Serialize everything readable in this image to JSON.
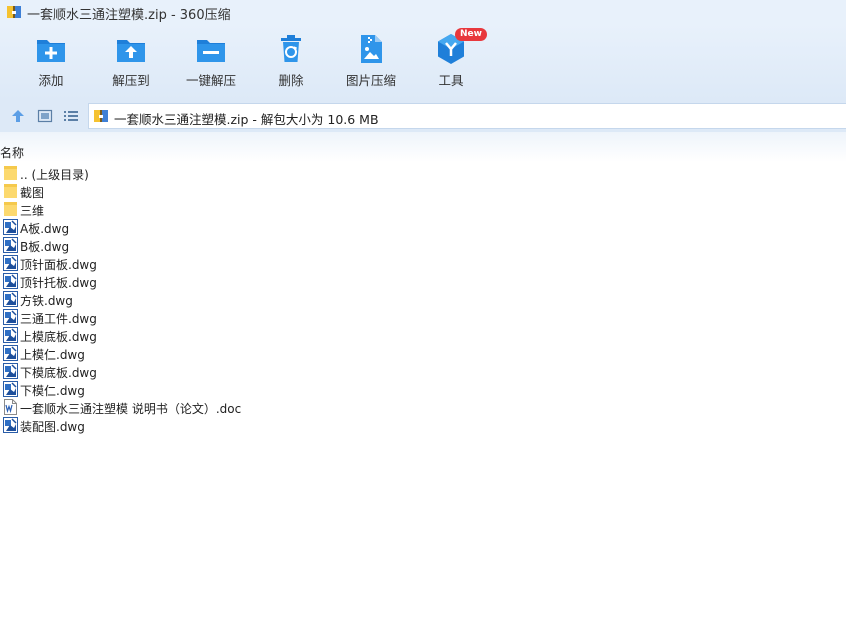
{
  "window": {
    "title": "一套顺水三通注塑模.zip - 360压缩"
  },
  "toolbar": {
    "items": [
      {
        "label": "添加",
        "icon": "add-icon"
      },
      {
        "label": "解压到",
        "icon": "extract-to-icon"
      },
      {
        "label": "一键解压",
        "icon": "one-click-extract-icon"
      },
      {
        "label": "删除",
        "icon": "delete-icon"
      },
      {
        "label": "图片压缩",
        "icon": "image-compress-icon"
      },
      {
        "label": "工具",
        "icon": "tools-icon",
        "badge": "New"
      }
    ]
  },
  "navbar": {
    "path_text": "一套顺水三通注塑模.zip - 解包大小为 10.6 MB"
  },
  "list": {
    "column_name": "名称",
    "files": [
      {
        "name": ".. (上级目录)",
        "type": "folder"
      },
      {
        "name": "截图",
        "type": "folder"
      },
      {
        "name": "三维",
        "type": "folder"
      },
      {
        "name": "A板.dwg",
        "type": "dwg"
      },
      {
        "name": "B板.dwg",
        "type": "dwg"
      },
      {
        "name": "顶针面板.dwg",
        "type": "dwg"
      },
      {
        "name": "顶针托板.dwg",
        "type": "dwg"
      },
      {
        "name": "方铁.dwg",
        "type": "dwg"
      },
      {
        "name": "三通工件.dwg",
        "type": "dwg"
      },
      {
        "name": "上模底板.dwg",
        "type": "dwg"
      },
      {
        "name": "上模仁.dwg",
        "type": "dwg"
      },
      {
        "name": "下模底板.dwg",
        "type": "dwg"
      },
      {
        "name": "下模仁.dwg",
        "type": "dwg"
      },
      {
        "name": "一套顺水三通注塑模 说明书（论文）.doc",
        "type": "doc"
      },
      {
        "name": "装配图.dwg",
        "type": "dwg"
      }
    ]
  },
  "colors": {
    "accent": "#2b8ae0",
    "toolbar_bg": "#e8f1fb",
    "folder": "#fcd96e",
    "badge": "#e8383d"
  }
}
